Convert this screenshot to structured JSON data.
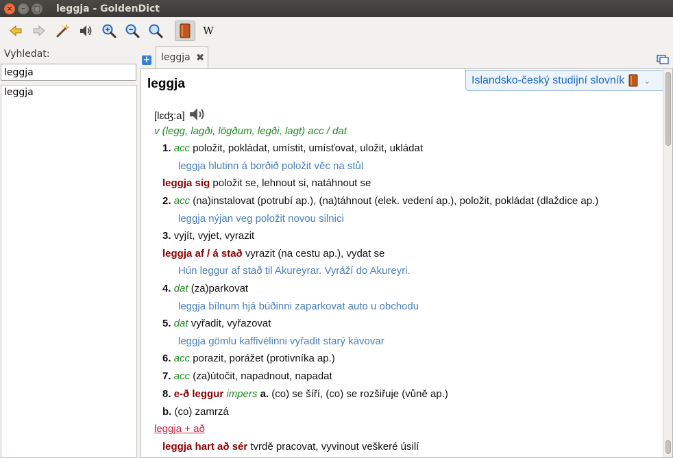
{
  "window": {
    "title": "leggja - GoldenDict"
  },
  "toolbar": {
    "buttons": [
      "back-icon",
      "forward-icon",
      "scan-wand-icon",
      "pronounce-icon",
      "zoom-in-icon",
      "zoom-out-icon",
      "zoom-reset-icon",
      "dictionary-book-icon",
      "wikipedia-icon"
    ],
    "wiki_label": "W"
  },
  "search": {
    "label": "Vyhledat:",
    "value": "leggja"
  },
  "wordlist": {
    "items": [
      "leggja"
    ]
  },
  "tabs": {
    "active_label": "leggja"
  },
  "article": {
    "headword": "leggja",
    "dictionary_name": "Islandsko-český studijní slovník",
    "phonetic": "[lɛʤ:a]",
    "grammar": "v (legg, lagði, lögðum, legði, lagt) acc / dat",
    "lines": {
      "s1_num": "1.",
      "s1_case": "acc",
      "s1_text": "položit, pokládat, umístit, umísťovat, uložit, ukládat",
      "s1_ex": "leggja hlutinn á borðið položit věc na stůl",
      "p1_phrase": "leggja sig",
      "p1_text": "položit se, lehnout si, natáhnout se",
      "s2_num": "2.",
      "s2_case": "acc",
      "s2_text": "(na)instalovat (potrubí ap.), (na)táhnout (elek. vedení ap.), položit, pokládat (dlaždice ap.)",
      "s2_ex": "leggja nýjan veg položit novou silnici",
      "s3_num": "3.",
      "s3_text": "vyjít, vyjet, vyrazit",
      "p2_phrase": "leggja af / á stað",
      "p2_text": "vyrazit (na cestu ap.), vydat se",
      "p2_ex": "Hún leggur af stað til Akureyrar. Vyráží do Akureyri.",
      "s4_num": "4.",
      "s4_case": "dat",
      "s4_text": "(za)parkovat",
      "s4_ex": "leggja bílnum hjá búðinni zaparkovat auto u obchodu",
      "s5_num": "5.",
      "s5_case": "dat",
      "s5_text": "vyřadit, vyřazovat",
      "s5_ex": "leggja gömlu kaffivélinni vyřadit starý kávovar",
      "s6_num": "6.",
      "s6_case": "acc",
      "s6_text": "porazit, porážet (protivníka ap.)",
      "s7_num": "7.",
      "s7_case": "acc",
      "s7_text": "(za)útočit, napadnout, napadat",
      "s8_num": "8.",
      "s8_phrase": "e-ð leggur",
      "s8_gram": "impers",
      "s8_a": "a.",
      "s8_text": "(co) se šíří, (co) se rozšiřuje (vůně ap.)",
      "s8b_num": "b.",
      "s8b_text": "(co) zamrzá",
      "link_text": "leggja + að",
      "p3_phrase": "leggja hart að sér",
      "p3_text": "tvrdě pracovat, vyvinout veškeré úsilí"
    }
  }
}
